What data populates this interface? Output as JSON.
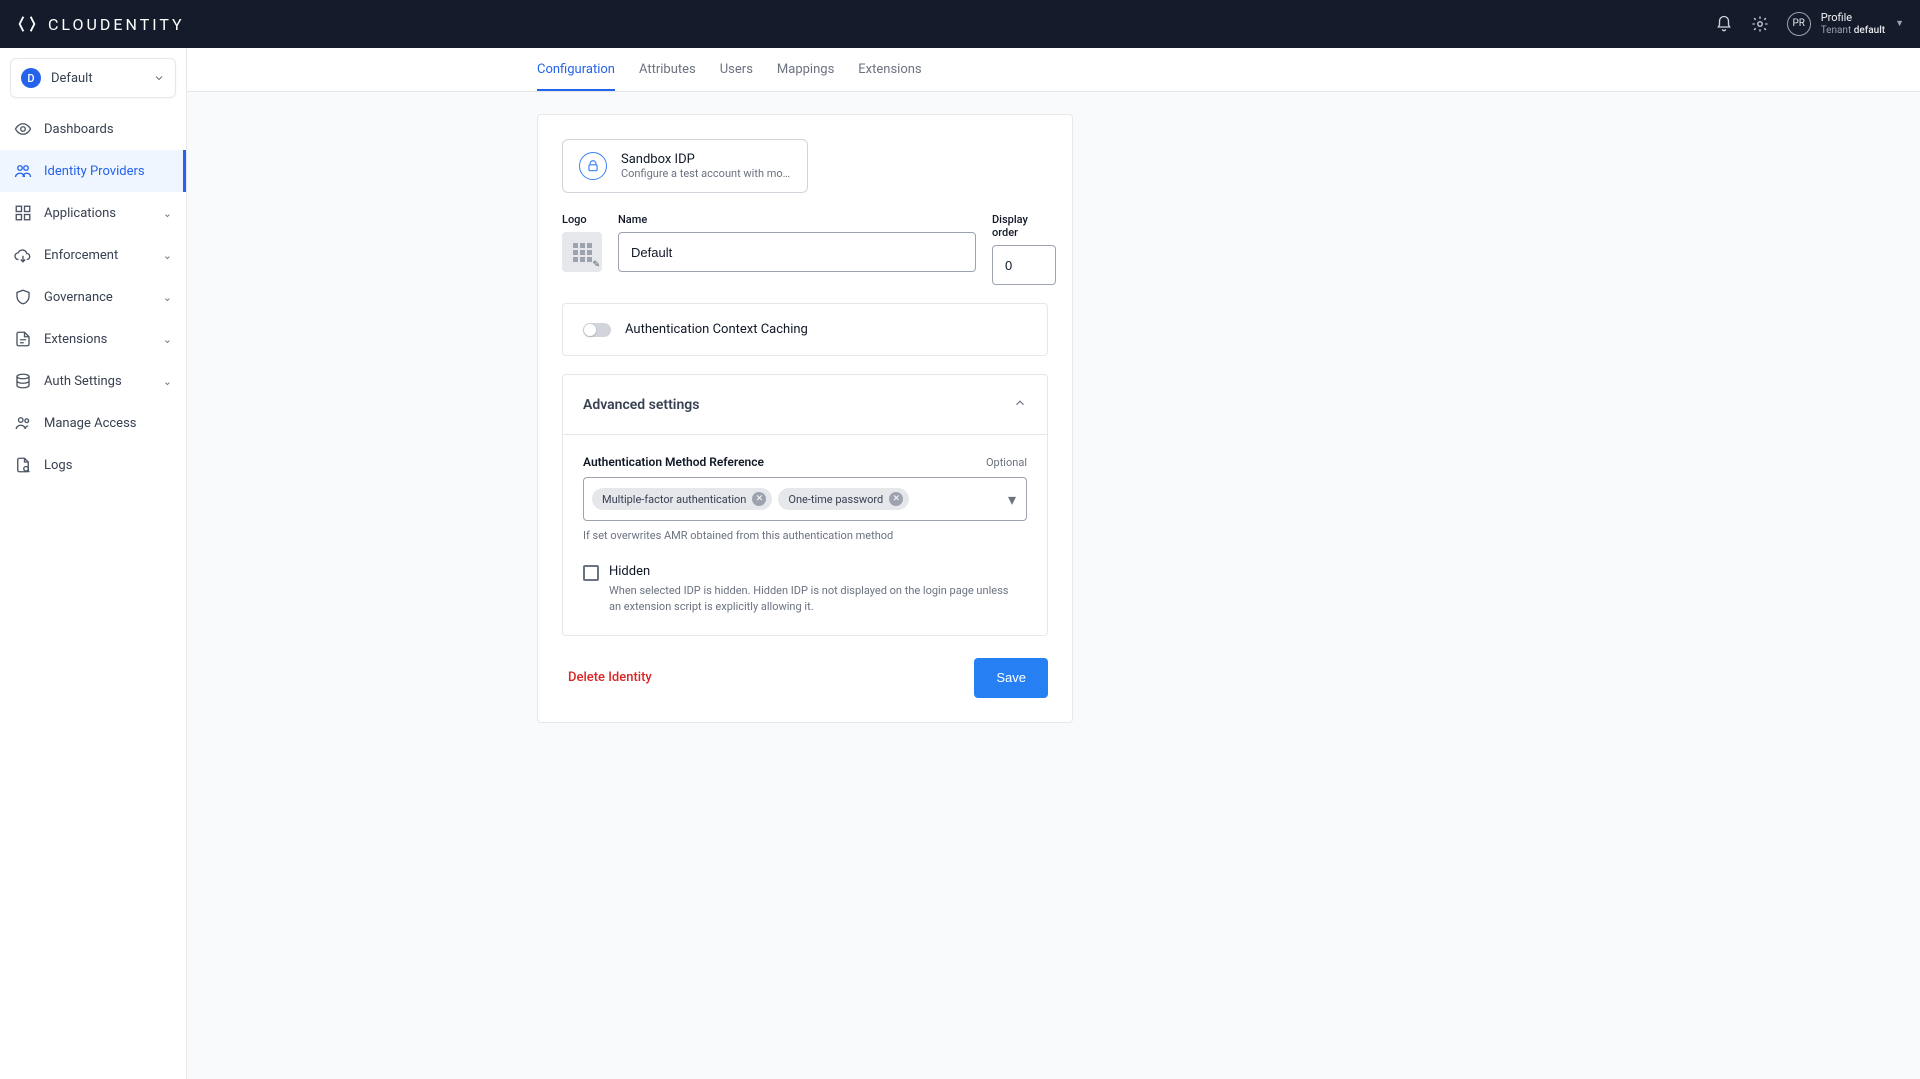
{
  "header": {
    "brand": "CLOUDENTITY",
    "profile_label": "Profile",
    "tenant_label": "Tenant",
    "tenant_value": "default",
    "avatar": "PR"
  },
  "sidebar": {
    "workspace_badge": "D",
    "workspace_name": "Default",
    "items": [
      {
        "label": "Dashboards",
        "expandable": false
      },
      {
        "label": "Identity Providers",
        "expandable": false,
        "active": true
      },
      {
        "label": "Applications",
        "expandable": true
      },
      {
        "label": "Enforcement",
        "expandable": true
      },
      {
        "label": "Governance",
        "expandable": true
      },
      {
        "label": "Extensions",
        "expandable": true
      },
      {
        "label": "Auth Settings",
        "expandable": true
      },
      {
        "label": "Manage Access",
        "expandable": false
      },
      {
        "label": "Logs",
        "expandable": false
      }
    ]
  },
  "tabs": [
    "Configuration",
    "Attributes",
    "Users",
    "Mappings",
    "Extensions"
  ],
  "idp_card": {
    "title": "Sandbox IDP",
    "desc": "Configure a test account with mock …"
  },
  "fields": {
    "logo_label": "Logo",
    "name_label": "Name",
    "name_value": "Default",
    "display_order_label": "Display order",
    "display_order_value": "0"
  },
  "toggle": {
    "label": "Authentication Context Caching"
  },
  "advanced": {
    "title": "Advanced settings",
    "amr_label": "Authentication Method Reference",
    "amr_optional": "Optional",
    "amr_chips": [
      "Multiple-factor authentication",
      "One-time password"
    ],
    "amr_help": "If set overwrites AMR obtained from this authentication method",
    "hidden_label": "Hidden",
    "hidden_desc": "When selected IDP is hidden. Hidden IDP is not displayed on the login page unless an extension script is explicitly allowing it."
  },
  "actions": {
    "delete": "Delete Identity",
    "save": "Save"
  }
}
